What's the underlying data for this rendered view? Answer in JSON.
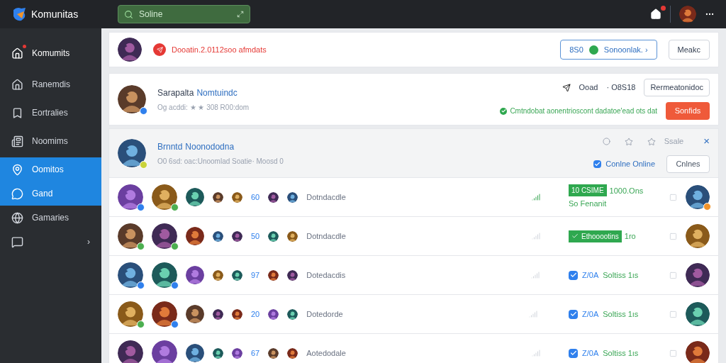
{
  "topbar": {
    "brand": "Komunitas",
    "search": {
      "value": "Soline"
    },
    "home_alert": true
  },
  "sidebar": {
    "items": [
      {
        "label": "Komumits",
        "alert": true,
        "selected": false
      },
      {
        "label": "Ranemdis",
        "alert": false,
        "selected": false
      },
      {
        "label": "Eortralies",
        "alert": false,
        "selected": false
      },
      {
        "label": "Noomims",
        "alert": false,
        "selected": false
      },
      {
        "label": "Oomitos",
        "alert": false,
        "selected": true
      },
      {
        "label": "Gand",
        "alert": false,
        "selected": true
      },
      {
        "label": "Gamaries",
        "alert": false,
        "selected": false
      },
      {
        "chevron": "›",
        "alert": false,
        "selected": false
      }
    ]
  },
  "notice": {
    "text": "Dooatin.2.0112soo afmdats",
    "status_button": {
      "count": "8S0",
      "label": "Sonoonlak. ›"
    },
    "button": "Meakc"
  },
  "profile": {
    "avatar": {
      "color": "#2f80ed"
    },
    "name": "Sarapalta",
    "handle": "Nomtuindc",
    "subtitle": "Og acddi: ★ ★ 308 R00:dom",
    "stat_label": "Ooad",
    "stat_value": "· O8S18",
    "secondary_button": "Rermeatonidoc",
    "message": "Cmtndobat aonentrioscont dadatoe'ead ots dat",
    "primary_button": "Sonfids"
  },
  "group": {
    "avatar": {
      "color": "#c9d33a"
    },
    "name": "Brnntd",
    "handle": "Noonododna",
    "subtitle": "O0 6sd: oac:Unoomlad Soatie· Moosd 0",
    "sort_label": "Ssale",
    "close": "×",
    "online_filter": {
      "label": "Conlne Online",
      "checked": true
    },
    "button": "Cnlnes"
  },
  "rows": [
    {
      "avatars": [
        {
          "color": "#2f80ed"
        },
        {
          "color": "#4caf50"
        }
      ],
      "count": "60",
      "label": "Dotndacdle",
      "status": {
        "kind": "tag",
        "check": false,
        "tag": "10 CSIME",
        "text": "1000.Ons",
        "note": "So Fenanit"
      },
      "end_avatar": {
        "color": "#f0932b"
      }
    },
    {
      "avatars": [
        {
          "color": "#4caf50"
        },
        {
          "color": "#4caf50"
        }
      ],
      "count": "50",
      "label": "Dotndacdle",
      "status": {
        "kind": "tag",
        "check": true,
        "tag": "Ethooootins",
        "text": "1ro"
      }
    },
    {
      "avatars": [
        {
          "color": "#2f80ed"
        },
        {
          "color": "#2f80ed"
        }
      ],
      "count": "97",
      "label": "Dotedacdis",
      "status": {
        "kind": "checkbox",
        "checked": true,
        "code": "Z/0A",
        "text": "Soltiss 1ıs"
      }
    },
    {
      "avatars": [
        {
          "color": "#4caf50"
        },
        {
          "color": "#2f80ed"
        }
      ],
      "count": "20",
      "label": "Dotedorde",
      "status": {
        "kind": "checkbox",
        "checked": true,
        "code": "Z/0A",
        "text": "Soltiss 1ıs"
      }
    },
    {
      "count": "67",
      "label": "Aotedodale",
      "status": {
        "kind": "checkbox",
        "checked": true,
        "code": "Z/0A",
        "text": "Soltiss 1ıs"
      }
    }
  ]
}
